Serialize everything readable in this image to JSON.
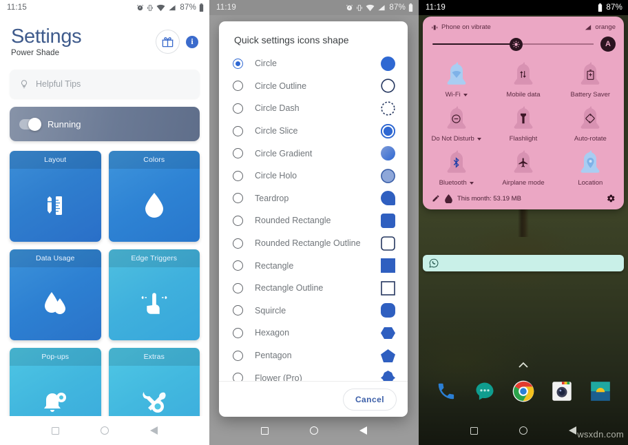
{
  "panel1": {
    "name": "power-shade-settings",
    "statusbar": {
      "time": "11:15",
      "battery_pct": "87%",
      "icons": [
        "alarm-icon",
        "vibrate-icon",
        "wifi-icon",
        "signal-icon",
        "battery-icon"
      ]
    },
    "header": {
      "title": "Settings",
      "subtitle": "Power Shade",
      "gift_button": "gift-icon",
      "info_button": "i"
    },
    "tips": {
      "placeholder": "Helpful Tips",
      "icon": "lightbulb-icon"
    },
    "running": {
      "label": "Running",
      "enabled": true
    },
    "tiles": [
      {
        "label": "Layout",
        "icon": "pencil-ruler-icon"
      },
      {
        "label": "Colors",
        "icon": "water-drop-icon"
      },
      {
        "label": "Data Usage",
        "icon": "data-drop-icon"
      },
      {
        "label": "Edge Triggers",
        "icon": "swipe-hand-icon"
      },
      {
        "label": "Pop-ups",
        "icon": "bell-gear-icon"
      },
      {
        "label": "Extras",
        "icon": "wrench-gear-icon"
      }
    ],
    "navbar": [
      "recents-button",
      "home-button",
      "back-button"
    ]
  },
  "panel2": {
    "name": "shape-picker-dialog",
    "statusbar": {
      "time": "11:19",
      "battery_pct": "87%"
    },
    "dialog": {
      "title": "Quick settings icons shape",
      "selected": "Circle",
      "options": [
        {
          "label": "Circle",
          "swatch": "circle-filled",
          "selected": true
        },
        {
          "label": "Circle Outline",
          "swatch": "circle-outline",
          "selected": false
        },
        {
          "label": "Circle Dash",
          "swatch": "circle-dashed",
          "selected": false
        },
        {
          "label": "Circle Slice",
          "swatch": "circle-slice",
          "selected": false
        },
        {
          "label": "Circle Gradient",
          "swatch": "circle-gradient",
          "selected": false
        },
        {
          "label": "Circle Holo",
          "swatch": "circle-holo",
          "selected": false
        },
        {
          "label": "Teardrop",
          "swatch": "teardrop",
          "selected": false
        },
        {
          "label": "Rounded Rectangle",
          "swatch": "rounded-rect-filled",
          "selected": false
        },
        {
          "label": "Rounded Rectangle Outline",
          "swatch": "rounded-rect-outline",
          "selected": false
        },
        {
          "label": "Rectangle",
          "swatch": "rect-filled",
          "selected": false
        },
        {
          "label": "Rectangle Outline",
          "swatch": "rect-outline",
          "selected": false
        },
        {
          "label": "Squircle",
          "swatch": "squircle",
          "selected": false
        },
        {
          "label": "Hexagon",
          "swatch": "hexagon",
          "selected": false
        },
        {
          "label": "Pentagon",
          "swatch": "pentagon",
          "selected": false
        },
        {
          "label": "Flower (Pro)",
          "swatch": "flower",
          "selected": false
        }
      ],
      "cancel_label": "Cancel"
    },
    "navbar": [
      "recents-button",
      "home-button",
      "back-button"
    ]
  },
  "panel3": {
    "name": "quick-settings-shade",
    "statusbar": {
      "time": "11:19",
      "battery_pct": "87%"
    },
    "shade": {
      "vibrate_text": "Phone on vibrate",
      "carrier": "orange",
      "brightness_pct": 52,
      "auto_brightness_label": "A",
      "tiles": [
        {
          "label": "Wi-Fi",
          "icon": "wifi-icon",
          "active": true,
          "caret": true
        },
        {
          "label": "Mobile data",
          "icon": "mobile-data-icon",
          "active": false,
          "caret": false
        },
        {
          "label": "Battery Saver",
          "icon": "battery-icon",
          "active": false,
          "caret": false
        },
        {
          "label": "Do Not Disturb",
          "icon": "dnd-icon",
          "active": false,
          "caret": true
        },
        {
          "label": "Flashlight",
          "icon": "flashlight-icon",
          "active": false,
          "caret": false
        },
        {
          "label": "Auto-rotate",
          "icon": "rotate-icon",
          "active": false,
          "caret": false
        },
        {
          "label": "Bluetooth",
          "icon": "bluetooth-icon",
          "active": false,
          "caret": true
        },
        {
          "label": "Airplane mode",
          "icon": "airplane-icon",
          "active": false,
          "caret": false
        },
        {
          "label": "Location",
          "icon": "location-icon",
          "active": true,
          "caret": false
        }
      ],
      "footer": {
        "edit_icon": "pencil-icon",
        "data_icon": "data-drop-icon",
        "data_text": "This month: 53.19 MB",
        "settings_icon": "gear-icon"
      }
    },
    "notification": {
      "app_icon": "whatsapp-icon"
    },
    "dock": [
      "phone-icon",
      "messages-icon",
      "chrome-icon",
      "camera-icon",
      "photos-icon"
    ],
    "home_arrow": "chevron-up-icon",
    "watermark": "wsxdn.com",
    "navbar": [
      "recents-button",
      "home-button",
      "back-button"
    ]
  },
  "colors": {
    "settings_title": "#3f5b8c",
    "accent_blue": "#2f68d2",
    "shade_pink": "#eba7c4",
    "shade_ink": "#5c2b42",
    "notif_teal": "#c9f0e8"
  }
}
